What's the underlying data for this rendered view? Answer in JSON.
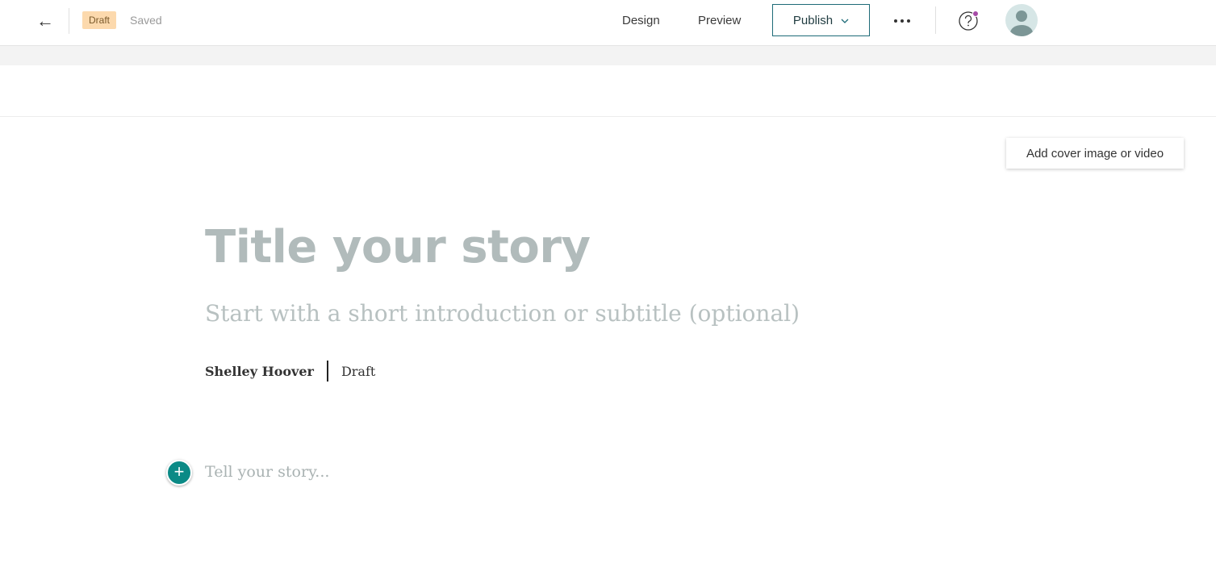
{
  "header": {
    "back_icon": "arrow-left-icon",
    "status_badge": "Draft",
    "save_status": "Saved",
    "nav": {
      "design_label": "Design",
      "preview_label": "Preview"
    },
    "publish_label": "Publish",
    "more_icon": "ellipsis-icon",
    "help_icon": "question-circle-icon",
    "notification_color": "#a64ba6",
    "avatar_icon": "user-avatar-icon"
  },
  "cover": {
    "button_label": "Add cover image or video"
  },
  "story": {
    "title_placeholder": "Title your story",
    "subtitle_placeholder": "Start with a short introduction or subtitle (optional)",
    "author": "Shelley Hoover",
    "status": "Draft",
    "body_placeholder": "Tell your story..."
  },
  "colors": {
    "accent": "#0b8a86",
    "publish_border": "#1e6b78",
    "badge_bg": "#fcd9ad"
  }
}
